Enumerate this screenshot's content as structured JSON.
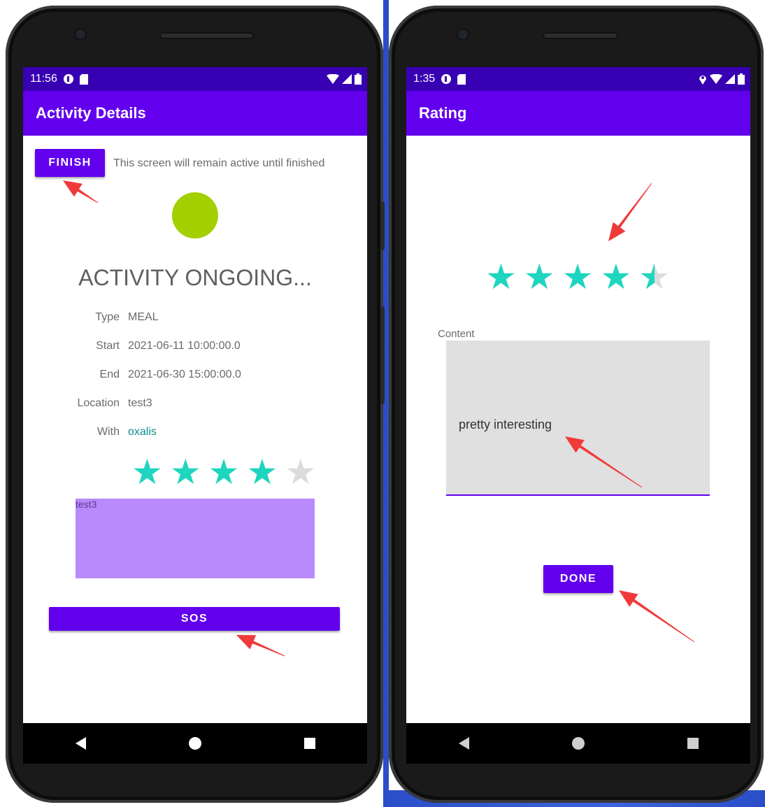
{
  "left_phone": {
    "status": {
      "time": "11:56"
    },
    "title": "Activity Details",
    "finish_label": "FINISH",
    "hint": "This screen will remain active until finished",
    "status_color": "#a3d000",
    "heading": "ACTIVITY ONGOING...",
    "details": [
      {
        "label": "Type",
        "value": "MEAL"
      },
      {
        "label": "Start",
        "value": "2021-06-11 10:00:00.0"
      },
      {
        "label": "End",
        "value": "2021-06-30 15:00:00.0"
      },
      {
        "label": "Location",
        "value": "test3"
      },
      {
        "label": "With",
        "value": "oxalis"
      }
    ],
    "rating": 4,
    "rating_max": 5,
    "comment": "test3",
    "sos_label": "SOS"
  },
  "right_phone": {
    "status": {
      "time": "1:35"
    },
    "title": "Rating",
    "rating": 4.5,
    "rating_max": 5,
    "content_label": "Content",
    "content_value": "pretty  interesting",
    "done_label": "DONE"
  },
  "colors": {
    "primary": "#6200ee",
    "primary_dark": "#3700b3",
    "star": "#1ed5bf",
    "star_off": "#dcdcdc",
    "comment_bg": "#b98afc",
    "link": "#0a8f8a",
    "arrow": "#f03a3a"
  },
  "icons": [
    "signal-icon",
    "wifi-icon",
    "battery-icon",
    "location-icon",
    "sd-card-icon",
    "back-icon",
    "home-icon",
    "recents-icon"
  ]
}
